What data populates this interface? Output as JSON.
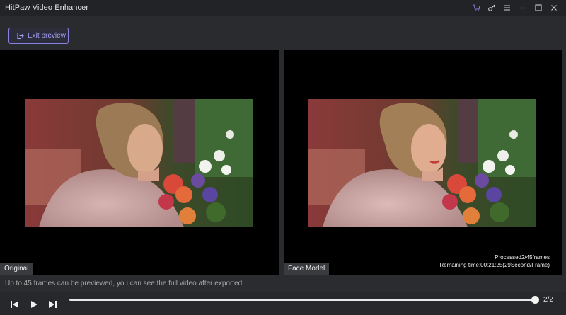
{
  "window": {
    "title": "HitPaw Video Enhancer",
    "controls": [
      "cart-icon",
      "key-icon",
      "menu-icon",
      "minimize-icon",
      "maximize-icon",
      "close-icon"
    ]
  },
  "toolbar": {
    "exit_preview_label": "Exit preview"
  },
  "preview": {
    "original_label": "Original",
    "enhanced_label": "Face Model",
    "processed_text": "Processed2/45frames",
    "remaining_text": "Remaining time:00:21:25(29Second/Frame)"
  },
  "hint": {
    "text": "Up to 45 frames can be previewed, you can see the full video after exported"
  },
  "playback": {
    "frame_counter": "2/2",
    "progress": 1.0
  },
  "colors": {
    "accent": "#8a82e0",
    "accent_text": "#a7a0f5",
    "background": "#2a2b2e",
    "titlebar": "#222326",
    "preview_bg": "#000000"
  }
}
